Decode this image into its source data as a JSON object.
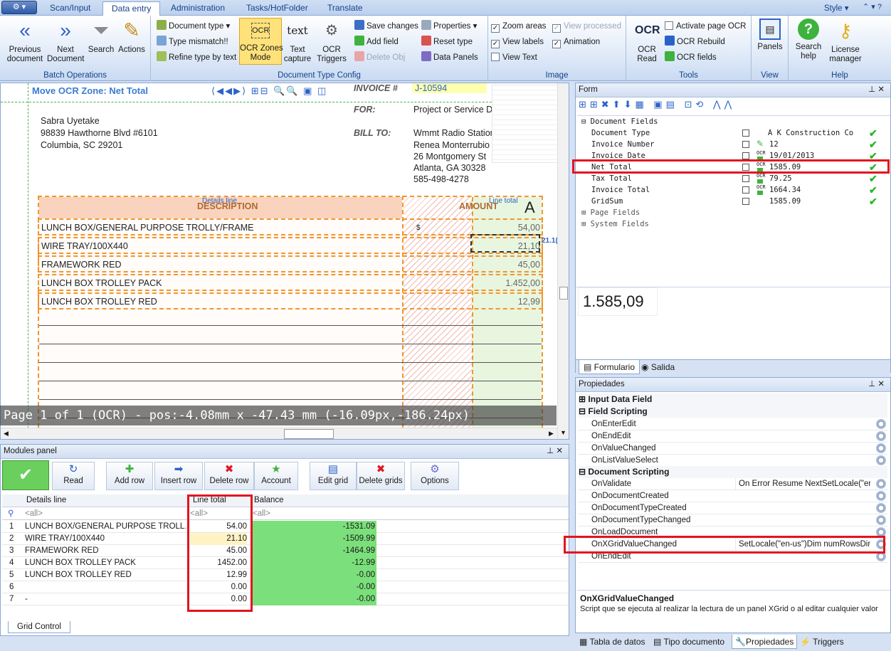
{
  "tabs": {
    "orb": "⚙ ▾",
    "items": [
      "Scan/Input",
      "Data entry",
      "Administration",
      "Tasks/HotFolder",
      "Translate"
    ],
    "style_label": "Style",
    "window_controls": "⌃ ▾ ?"
  },
  "ribbon": {
    "batch": {
      "prev": "Previous\ndocument",
      "next": "Next\nDocument",
      "search": "Search",
      "actions": "Actions",
      "label": "Batch Operations"
    },
    "doctype": {
      "document_type": "Document type",
      "type_mismatch": "Type mismatch!!",
      "refine_type": "Refine type by text",
      "ocr_zones": "OCR Zones\nMode",
      "text_capture": "Text\ncapture",
      "ocr_triggers": "OCR\nTriggers",
      "save_changes": "Save changes",
      "add_field": "Add field",
      "delete_obj": "Delete Obj",
      "properties": "Properties",
      "reset_type": "Reset type",
      "data_panels": "Data Panels",
      "label": "Document Type Config"
    },
    "image": {
      "zoom_areas": "Zoom areas",
      "view_processed": "View processed",
      "view_labels": "View labels",
      "animation": "Animation",
      "view_text": "View Text",
      "label": "Image"
    },
    "tools": {
      "ocr_read": "OCR\nRead",
      "activate_page_ocr": "Activate page OCR",
      "ocr_rebuild": "OCR Rebuild",
      "ocr_fields": "OCR fields",
      "label": "Tools"
    },
    "view": {
      "panels": "Panels",
      "label": "View"
    },
    "help": {
      "search_help": "Search\nhelp",
      "license_manager": "License\nmanager",
      "label": "Help"
    }
  },
  "document": {
    "zone_title": "Move OCR Zone: Net Total",
    "invoice_label": "INVOICE #",
    "invoice_number": "J-10594",
    "for_label": "FOR:",
    "for_value": "Project or Service Description",
    "bill_to_label": "BILL TO:",
    "sender": [
      "Sabra Uyetake",
      "98839 Hawthorne Blvd #6101",
      "Columbia, SC 29201"
    ],
    "bill_to": [
      "Wmmt Radio Station",
      "Renea Monterrubio",
      "26 Montgomery St",
      "Atlanta, GA 30328",
      "585-498-4278"
    ],
    "col_details": "Details line",
    "col_description": "DESCRIPTION",
    "col_amount": "AMOUNT",
    "col_line_total": "Line total",
    "big_letter": "A",
    "dollar": "$",
    "tooltip_value": "21.1(",
    "rows": [
      {
        "desc": "LUNCH BOX/GENERAL PURPOSE TROLLY/FRAME",
        "amount": "54,00"
      },
      {
        "desc": "WIRE TRAY/100X440",
        "amount": "21,10"
      },
      {
        "desc": "FRAMEWORK RED",
        "amount": "45,00"
      },
      {
        "desc": "LUNCH BOX TROLLEY PACK",
        "amount": "1.452,00"
      },
      {
        "desc": "LUNCH BOX TROLLEY RED",
        "amount": "12,99"
      }
    ],
    "status": "Page 1 of 1 (OCR) - pos:-4.08mm x -47.43 mm (-16.09px,-186.24px)"
  },
  "modules": {
    "title": "Modules panel",
    "buttons": [
      "Read",
      "Add row",
      "Insert row",
      "Delete row",
      "Account",
      "Edit grid",
      "Delete grids",
      "Options"
    ],
    "columns": [
      "Details line",
      "Line total",
      "Balance"
    ],
    "filter": "<all>",
    "rows": [
      {
        "n": "1",
        "details": "LUNCH BOX/GENERAL PURPOSE TROLL...",
        "total": "54.00",
        "balance": "-1531.09"
      },
      {
        "n": "2",
        "details": "WIRE TRAY/100X440",
        "total": "21.10",
        "balance": "-1509.99"
      },
      {
        "n": "3",
        "details": "FRAMEWORK RED",
        "total": "45.00",
        "balance": "-1464.99"
      },
      {
        "n": "4",
        "details": "LUNCH BOX TROLLEY PACK",
        "total": "1452.00",
        "balance": "-12.99"
      },
      {
        "n": "5",
        "details": "LUNCH BOX TROLLEY RED",
        "total": "12.99",
        "balance": "-0.00"
      },
      {
        "n": "6",
        "details": "",
        "total": "0.00",
        "balance": "-0.00"
      },
      {
        "n": "7",
        "details": "-",
        "total": "0.00",
        "balance": "-0.00"
      }
    ],
    "bottom_tab": "Grid Control"
  },
  "form": {
    "title": "Form",
    "document_fields_label": "Document Fields",
    "fields": [
      {
        "name": "Document Type",
        "value": "A K Construction Co",
        "flag": ""
      },
      {
        "name": "Invoice Number",
        "value": "12",
        "flag": "pen"
      },
      {
        "name": "Invoice Date",
        "value": "19/01/2013",
        "flag": "ocr"
      },
      {
        "name": "Net Total",
        "value": "1585.09",
        "flag": "ocr"
      },
      {
        "name": "Tax Total",
        "value": "79.25",
        "flag": "ocr"
      },
      {
        "name": "Invoice Total",
        "value": "1664.34",
        "flag": "ocr"
      },
      {
        "name": "GridSum",
        "value": "1585.09",
        "flag": ""
      }
    ],
    "ocr_tag": "OCR",
    "page_fields": "Page Fields",
    "system_fields": "System Fields",
    "preview_value": "1.585,09",
    "tabs": [
      "Formulario",
      "Salida"
    ]
  },
  "properties": {
    "title": "Propiedades",
    "categories": [
      "Input Data Field",
      "Field Scripting",
      "Document Scripting"
    ],
    "field_scripting": [
      "OnEnterEdit",
      "OnEndEdit",
      "OnValueChanged",
      "OnListValueSelect"
    ],
    "document_scripting": [
      {
        "name": "OnValidate",
        "value": "On Error Resume NextSetLocale(\"en-..."
      },
      {
        "name": "OnDocumentCreated",
        "value": ""
      },
      {
        "name": "OnDocumentTypeCreated",
        "value": ""
      },
      {
        "name": "OnDocumentTypeChanged",
        "value": ""
      },
      {
        "name": "OnLoadDocument",
        "value": ""
      },
      {
        "name": "OnXGridValueChanged",
        "value": "SetLocale(\"en-us\")Dim numRowsDim..."
      },
      {
        "name": "OnEndEdit",
        "value": ""
      }
    ],
    "desc_title": "OnXGridValueChanged",
    "desc_text": "Script que se ejecuta al realizar la lectura de un panel XGrid o al editar cualquier valor",
    "bottom_tabs": [
      "Tabla de datos",
      "Tipo documento",
      "Propiedades",
      "Triggers"
    ]
  },
  "colors": {
    "highlight": "#e3141f",
    "zone": "#f0962e",
    "balance": "#7be07b",
    "accent": "#15428b"
  }
}
